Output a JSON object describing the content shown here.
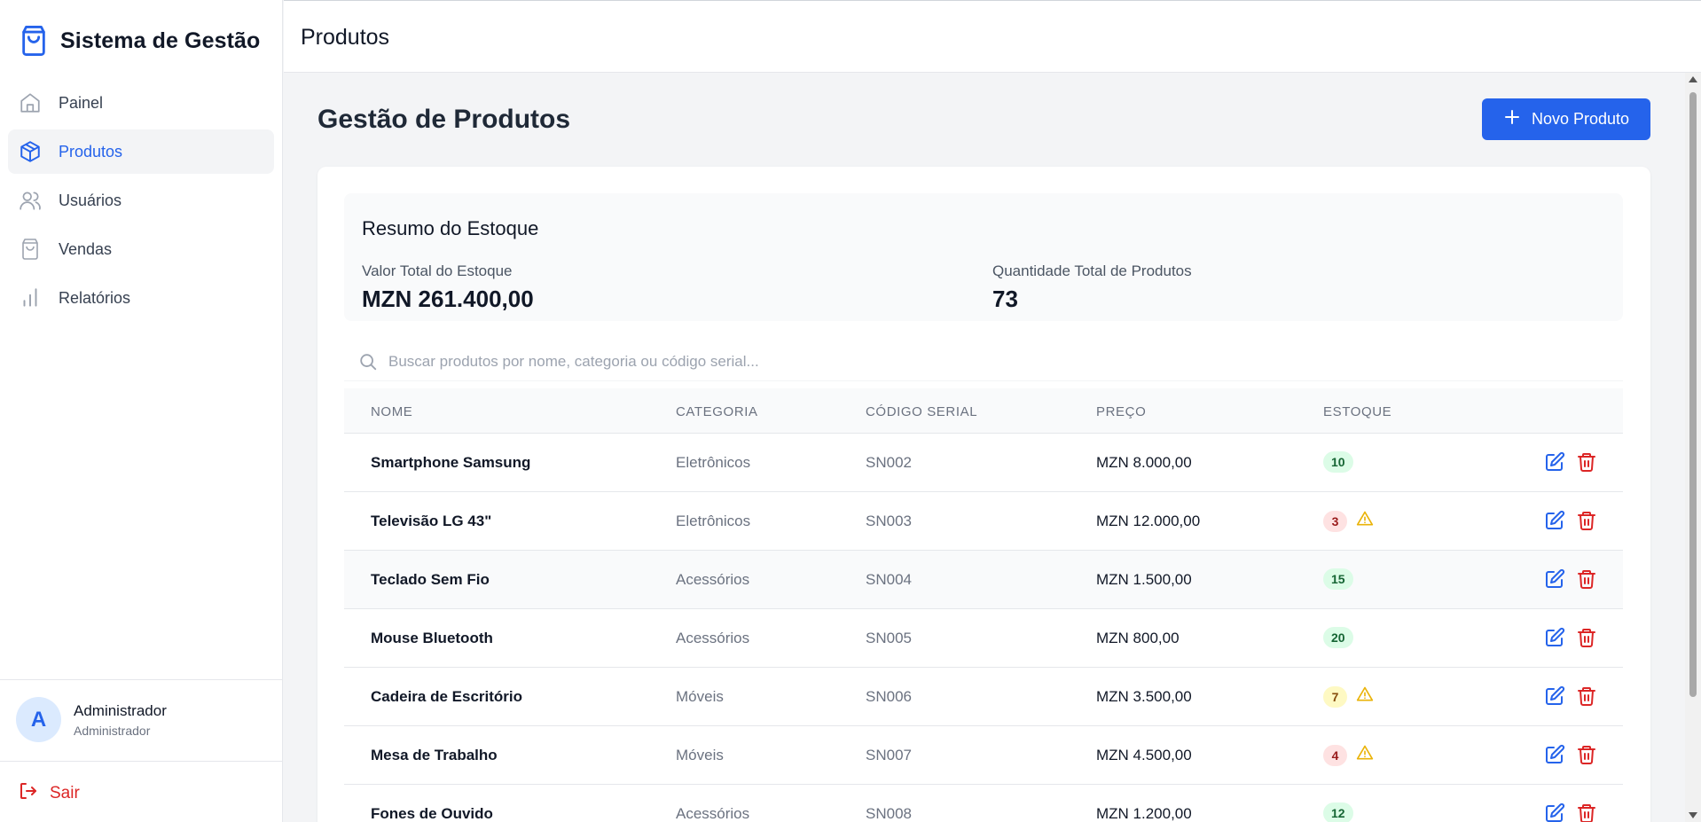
{
  "sidebar": {
    "brand": {
      "title": "Sistema de Gestão",
      "icon": "shopping-bag-icon"
    },
    "items": [
      {
        "label": "Painel",
        "icon": "home-icon",
        "active": false
      },
      {
        "label": "Produtos",
        "icon": "package-icon",
        "active": true
      },
      {
        "label": "Usuários",
        "icon": "users-icon",
        "active": false
      },
      {
        "label": "Vendas",
        "icon": "shopping-bag-icon",
        "active": false
      },
      {
        "label": "Relatórios",
        "icon": "bar-chart-icon",
        "active": false
      }
    ],
    "user": {
      "initial": "A",
      "name": "Administrador",
      "role": "Administrador"
    },
    "logout_label": "Sair"
  },
  "header": {
    "title": "Produtos"
  },
  "main": {
    "title": "Gestão de Produtos",
    "new_button_label": "Novo Produto",
    "summary": {
      "title": "Resumo do Estoque",
      "total_value_label": "Valor Total do Estoque",
      "total_value": "MZN 261.400,00",
      "total_qty_label": "Quantidade Total de Produtos",
      "total_qty": "73"
    },
    "search": {
      "placeholder": "Buscar produtos por nome, categoria ou código serial...",
      "value": ""
    },
    "table": {
      "columns": [
        "NOME",
        "CATEGORIA",
        "CÓDIGO SERIAL",
        "PREÇO",
        "ESTOQUE"
      ],
      "rows": [
        {
          "name": "Smartphone Samsung",
          "category": "Eletrônicos",
          "serial": "SN002",
          "price": "MZN 8.000,00",
          "stock": "10",
          "status": "ok"
        },
        {
          "name": "Televisão LG 43\"",
          "category": "Eletrônicos",
          "serial": "SN003",
          "price": "MZN 12.000,00",
          "stock": "3",
          "status": "low"
        },
        {
          "name": "Teclado Sem Fio",
          "category": "Acessórios",
          "serial": "SN004",
          "price": "MZN 1.500,00",
          "stock": "15",
          "status": "ok"
        },
        {
          "name": "Mouse Bluetooth",
          "category": "Acessórios",
          "serial": "SN005",
          "price": "MZN 800,00",
          "stock": "20",
          "status": "ok"
        },
        {
          "name": "Cadeira de Escritório",
          "category": "Móveis",
          "serial": "SN006",
          "price": "MZN 3.500,00",
          "stock": "7",
          "status": "warn"
        },
        {
          "name": "Mesa de Trabalho",
          "category": "Móveis",
          "serial": "SN007",
          "price": "MZN 4.500,00",
          "stock": "4",
          "status": "low"
        },
        {
          "name": "Fones de Ouvido",
          "category": "Acessórios",
          "serial": "SN008",
          "price": "MZN 1.200,00",
          "stock": "12",
          "status": "ok"
        }
      ]
    }
  },
  "colors": {
    "accent": "#2563eb",
    "danger": "#dc2626",
    "warning": "#eab308"
  }
}
